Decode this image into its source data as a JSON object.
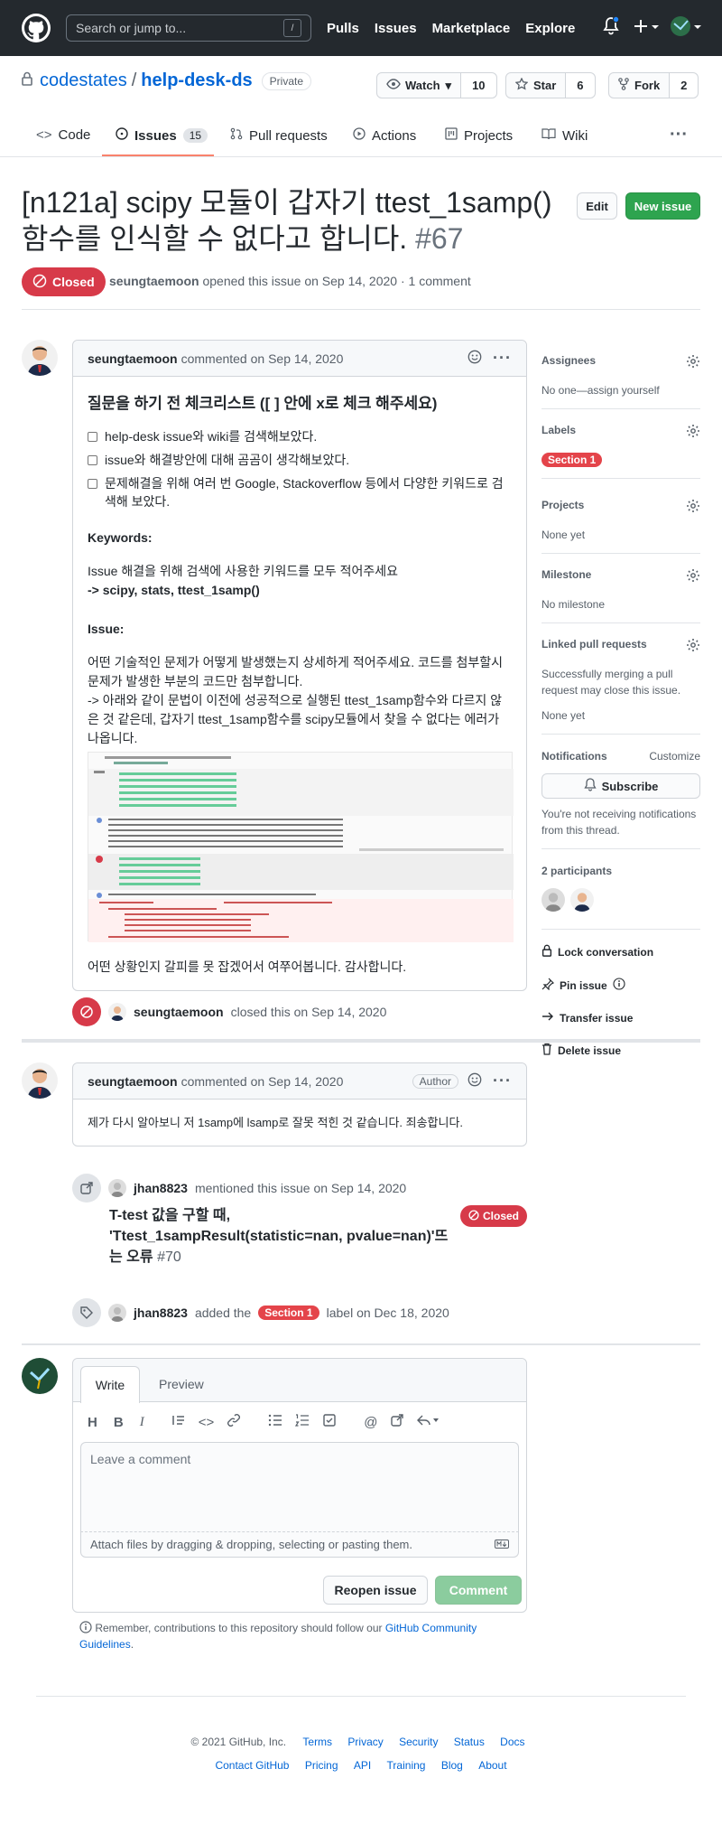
{
  "header": {
    "search_placeholder": "Search or jump to...",
    "search_key": "/",
    "nav": [
      "Pulls",
      "Issues",
      "Marketplace",
      "Explore"
    ]
  },
  "repo": {
    "owner": "codestates",
    "sep": "/",
    "name": "help-desk-ds",
    "visibility": "Private",
    "watch": {
      "label": "Watch",
      "count": "10"
    },
    "star": {
      "label": "Star",
      "count": "6"
    },
    "fork": {
      "label": "Fork",
      "count": "2"
    }
  },
  "tabs": {
    "code": "Code",
    "issues": "Issues",
    "issues_count": "15",
    "pulls": "Pull requests",
    "actions": "Actions",
    "projects": "Projects",
    "wiki": "Wiki"
  },
  "issue": {
    "title": "[n121a] scipy 모듈이 갑자기 ttest_1samp()함수를 인식할 수 없다고 합니다.",
    "number": "#67",
    "edit": "Edit",
    "new_issue": "New issue",
    "state": "Closed",
    "author": "seungtaemoon",
    "opened_text": "opened this issue on Sep 14, 2020 · 1 comment"
  },
  "comment1": {
    "author": "seungtaemoon",
    "date": "commented on Sep 14, 2020",
    "heading": "질문을 하기 전 체크리스트 ([ ] 안에 x로 체크 해주세요)",
    "checks": [
      "help-desk issue와 wiki를 검색해보았다.",
      "issue와 해결방안에 대해 곰곰이 생각해보았다.",
      "문제해결을 위해 여러 번 Google, Stackoverflow 등에서 다양한 키워드로 검색해 보았다."
    ],
    "keywords_title": "Keywords:",
    "keywords_desc": "Issue 해결을 위해 검색에 사용한 키워드를 모두 적어주세요",
    "keywords_value": "-> scipy, stats, ttest_1samp()",
    "issue_title": "Issue:",
    "issue_desc": "어떤 기술적인 문제가 어떻게 발생했는지 상세하게 적어주세요. 코드를 첨부할시 문제가 발생한 부분의 코드만 첨부합니다.",
    "issue_detail": "-> 아래와 같이 문법이 이전에 성공적으로 실행된 ttest_1samp함수와 다르지 않은 것 같은데, 갑자기 ttest_1samp함수를 scipy모듈에서 찾을 수 없다는 에러가 나옵니다.",
    "closing": "어떤 상황인지 갈피를 못 잡겠어서 여쭈어봅니다. 감사합니다."
  },
  "event_closed": {
    "author": "seungtaemoon",
    "text": "closed this on Sep 14, 2020"
  },
  "comment2": {
    "author": "seungtaemoon",
    "date": "commented on Sep 14, 2020",
    "badge": "Author",
    "body": "제가 다시 알아보니 저 1samp에 lsamp로 잘못 적힌 것 같습니다. 죄송합니다."
  },
  "event_mention": {
    "author": "jhan8823",
    "text": "mentioned this issue on Sep 14, 2020",
    "ref_title": "T-test 값을 구할 때, 'Ttest_1sampResult(statistic=nan, pvalue=nan)'뜨는 오류",
    "ref_num": "#70",
    "ref_state": "Closed"
  },
  "event_label": {
    "author": "jhan8823",
    "pre": "added the",
    "label": "Section 1",
    "post": "label on Dec 18, 2020"
  },
  "composer": {
    "write": "Write",
    "preview": "Preview",
    "placeholder": "Leave a comment",
    "attach": "Attach files by dragging & dropping, selecting or pasting them.",
    "reopen": "Reopen issue",
    "comment": "Comment",
    "remember": "Remember, contributions to this repository should follow our",
    "guidelines": "GitHub Community Guidelines",
    "period": "."
  },
  "sidebar": {
    "assignees": "Assignees",
    "assignees_val": "No one—assign yourself",
    "labels": "Labels",
    "label_val": "Section 1",
    "projects": "Projects",
    "projects_val": "None yet",
    "milestone": "Milestone",
    "milestone_val": "No milestone",
    "linked": "Linked pull requests",
    "linked_desc": "Successfully merging a pull request may close this issue.",
    "linked_val": "None yet",
    "notifications": "Notifications",
    "customize": "Customize",
    "subscribe": "Subscribe",
    "notif_desc": "You're not receiving notifications from this thread.",
    "participants": "2 participants",
    "lock": "Lock conversation",
    "pin": "Pin issue",
    "transfer": "Transfer issue",
    "delete": "Delete issue"
  },
  "footer": {
    "copyright": "© 2021 GitHub, Inc.",
    "links1": [
      "Terms",
      "Privacy",
      "Security",
      "Status",
      "Docs"
    ],
    "links2": [
      "Contact GitHub",
      "Pricing",
      "API",
      "Training",
      "Blog",
      "About"
    ]
  },
  "colors": {
    "closed": "#d73a49",
    "green": "#2ea44f",
    "link": "#0366d6",
    "label": "#e4444a"
  }
}
